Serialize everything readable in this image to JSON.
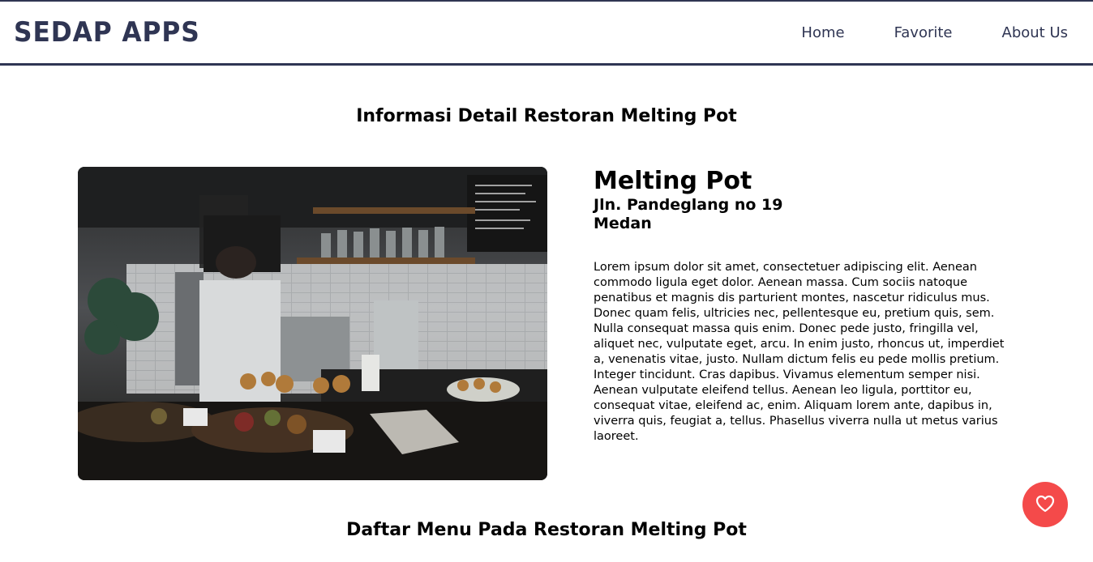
{
  "header": {
    "brand": "SEDAP APPS",
    "nav": [
      {
        "label": "Home"
      },
      {
        "label": "Favorite"
      },
      {
        "label": "About Us"
      }
    ]
  },
  "detail": {
    "section_title": "Informasi Detail Restoran Melting Pot",
    "image_alt": "Melting Pot",
    "name": "Melting Pot",
    "address": "Jln. Pandeglang no 19",
    "city": "Medan",
    "description": "Lorem ipsum dolor sit amet, consectetuer adipiscing elit. Aenean commodo ligula eget dolor. Aenean massa. Cum sociis natoque penatibus et magnis dis parturient montes, nascetur ridiculus mus. Donec quam felis, ultricies nec, pellentesque eu, pretium quis, sem. Nulla consequat massa quis enim. Donec pede justo, fringilla vel, aliquet nec, vulputate eget, arcu. In enim justo, rhoncus ut, imperdiet a, venenatis vitae, justo. Nullam dictum felis eu pede mollis pretium. Integer tincidunt. Cras dapibus. Vivamus elementum semper nisi. Aenean vulputate eleifend tellus. Aenean leo ligula, porttitor eu, consequat vitae, eleifend ac, enim. Aliquam lorem ante, dapibus in, viverra quis, feugiat a, tellus. Phasellus viverra nulla ut metus varius laoreet."
  },
  "menu": {
    "section_title": "Daftar Menu Pada Restoran Melting Pot"
  },
  "favorite_button": {
    "icon": "heart-icon",
    "color": "#f44a4a"
  },
  "theme": {
    "primary": "#2f3553"
  }
}
